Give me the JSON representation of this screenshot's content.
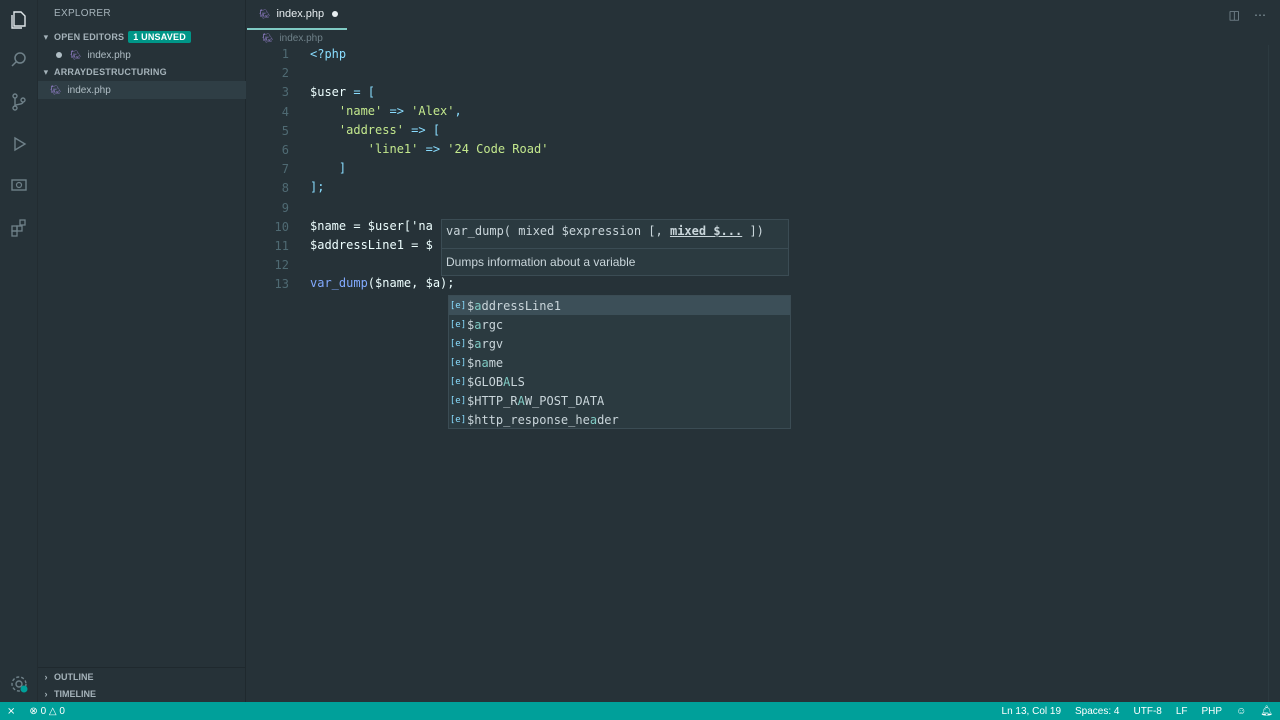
{
  "sidebar": {
    "title": "EXPLORER",
    "open_editors": {
      "label": "OPEN EDITORS",
      "badge": "1 UNSAVED",
      "file": "index.php"
    },
    "folder": {
      "label": "ARRAYDESTRUCTURING",
      "file": "index.php"
    },
    "outline_label": "OUTLINE",
    "timeline_label": "TIMELINE"
  },
  "tab": {
    "label": "index.php"
  },
  "breadcrumb": "index.php",
  "editor": {
    "line_numbers": [
      "1",
      "2",
      "3",
      "4",
      "5",
      "6",
      "7",
      "8",
      "9",
      "10",
      "11",
      "12",
      "13"
    ],
    "lines": {
      "l1": "<?php",
      "l3a": "$user",
      "l3b": " = [",
      "l4a": "    'name'",
      "l4b": " => ",
      "l4c": "'Alex'",
      "l4d": ",",
      "l5a": "    'address'",
      "l5b": " => [",
      "l6a": "        'line1'",
      "l6b": " => ",
      "l6c": "'24 Code Road'",
      "l7": "    ]",
      "l8": "];",
      "l10": "$name = $user['na",
      "l11": "$addressLine1 = $",
      "l13a": "var_dump",
      "l13b": "($name, $a);"
    }
  },
  "signature": {
    "prefix": "var_dump( mixed $expression [, ",
    "active_param": "mixed $...",
    "suffix": " ])",
    "description": "Dumps information about a variable"
  },
  "suggestions": [
    {
      "pre": "$",
      "hl": "a",
      "rest": "ddressLine1"
    },
    {
      "pre": "$",
      "hl": "a",
      "rest": "rgc"
    },
    {
      "pre": "$",
      "hl": "a",
      "rest": "rgv"
    },
    {
      "pre": "$n",
      "hl": "a",
      "rest": "me"
    },
    {
      "pre": "$GLOB",
      "hl": "A",
      "rest": "LS"
    },
    {
      "pre": "$HTTP_R",
      "hl": "A",
      "rest": "W_POST_DATA"
    },
    {
      "pre": "$http_response_he",
      "hl": "a",
      "rest": "der"
    }
  ],
  "status": {
    "problems_errors": "0",
    "problems_warnings": "0",
    "position": "Ln 13, Col 19",
    "spaces": "Spaces: 4",
    "encoding": "UTF-8",
    "eol": "LF",
    "language": "PHP"
  },
  "colors": {
    "accent": "#009688",
    "status_bar": "#00a09a",
    "background": "#263238"
  }
}
